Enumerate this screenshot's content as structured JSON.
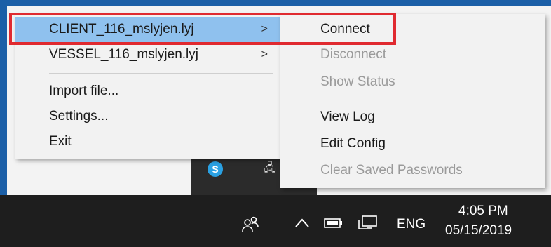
{
  "main_menu": {
    "items": [
      {
        "label": "CLIENT_116_mslyjen.lyj",
        "has_submenu": true,
        "selected": true
      },
      {
        "label": "VESSEL_116_mslyjen.lyj",
        "has_submenu": true,
        "selected": false
      },
      {
        "label": "Import file...",
        "has_submenu": false
      },
      {
        "label": "Settings...",
        "has_submenu": false
      },
      {
        "label": "Exit",
        "has_submenu": false
      }
    ],
    "arrow_glyph": ">"
  },
  "sub_menu": {
    "items": [
      {
        "label": "Connect",
        "enabled": true
      },
      {
        "label": "Disconnect",
        "enabled": false
      },
      {
        "label": "Show Status",
        "enabled": false
      },
      {
        "label": "View Log",
        "enabled": true
      },
      {
        "label": "Edit Config",
        "enabled": true
      },
      {
        "label": "Clear Saved Passwords",
        "enabled": false
      }
    ]
  },
  "taskbar": {
    "tray_icons": [
      "people-icon",
      "chevron-up-icon",
      "battery-icon",
      "network-icon"
    ],
    "language": "ENG",
    "time": "4:05 PM",
    "date": "05/15/2019"
  },
  "tray_popup_icons": [
    "skype-icon",
    "network-adapter-icon"
  ],
  "colors": {
    "selection": "#8fc1ee",
    "highlight_border": "#e02a30",
    "disabled_text": "#9a9a9a",
    "taskbar": "#1e1e1e"
  }
}
